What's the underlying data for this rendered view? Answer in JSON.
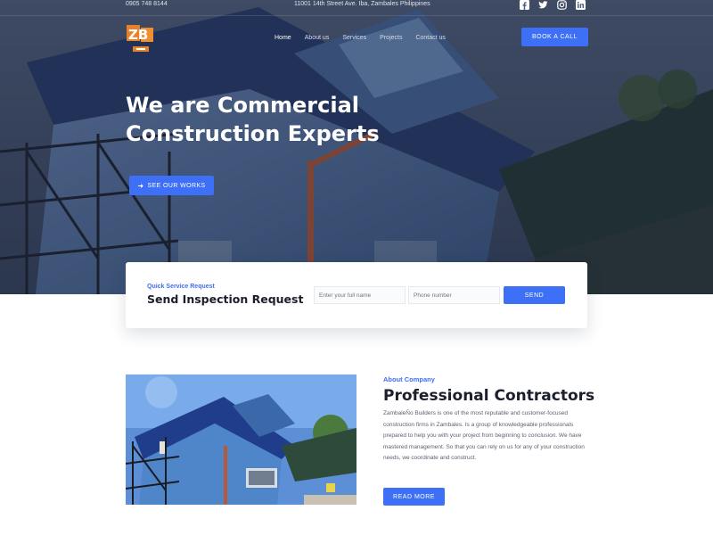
{
  "topbar": {
    "phone": "0905 748 8144",
    "address": "11001 14th Street Ave. Iba, Zambales Philippines",
    "socials": [
      {
        "name": "facebook-icon",
        "glyph": "f"
      },
      {
        "name": "twitter-icon",
        "glyph": "t"
      },
      {
        "name": "instagram-icon",
        "glyph": "ig"
      },
      {
        "name": "linkedin-icon",
        "glyph": "in"
      }
    ]
  },
  "navbar": {
    "logo_text": "ZB",
    "links": [
      {
        "label": "Home",
        "active": true
      },
      {
        "label": "About us",
        "active": false
      },
      {
        "label": "Services",
        "active": false
      },
      {
        "label": "Projects",
        "active": false
      },
      {
        "label": "Contact us",
        "active": false
      }
    ],
    "book_label": "BOOK A CALL"
  },
  "hero": {
    "title": "We are Commercial Construction Experts",
    "cta_label": "SEE OUR WORKS"
  },
  "inspection": {
    "eyebrow": "Quick Service Request",
    "title": "Send Inspection Request",
    "name_placeholder": "Enter your full name",
    "phone_placeholder": "Phone number",
    "send_label": "SEND"
  },
  "about": {
    "eyebrow": "About Company",
    "title": "Professional Contractors",
    "text": "ZambaleÑo Builders is one of the most reputable and customer-focused construction firms in Zambales. Is a group of knowledgeable professionals prepared to help you with your project from beginning to conclusion. We have mastered management. So that you can rely on us for any of your construction needs, we coordinate and construct.",
    "read_more_label": "READ MORE"
  },
  "colors": {
    "accent": "#3d6ff7",
    "heading": "#1c1e2b",
    "body": "#5c6270"
  }
}
